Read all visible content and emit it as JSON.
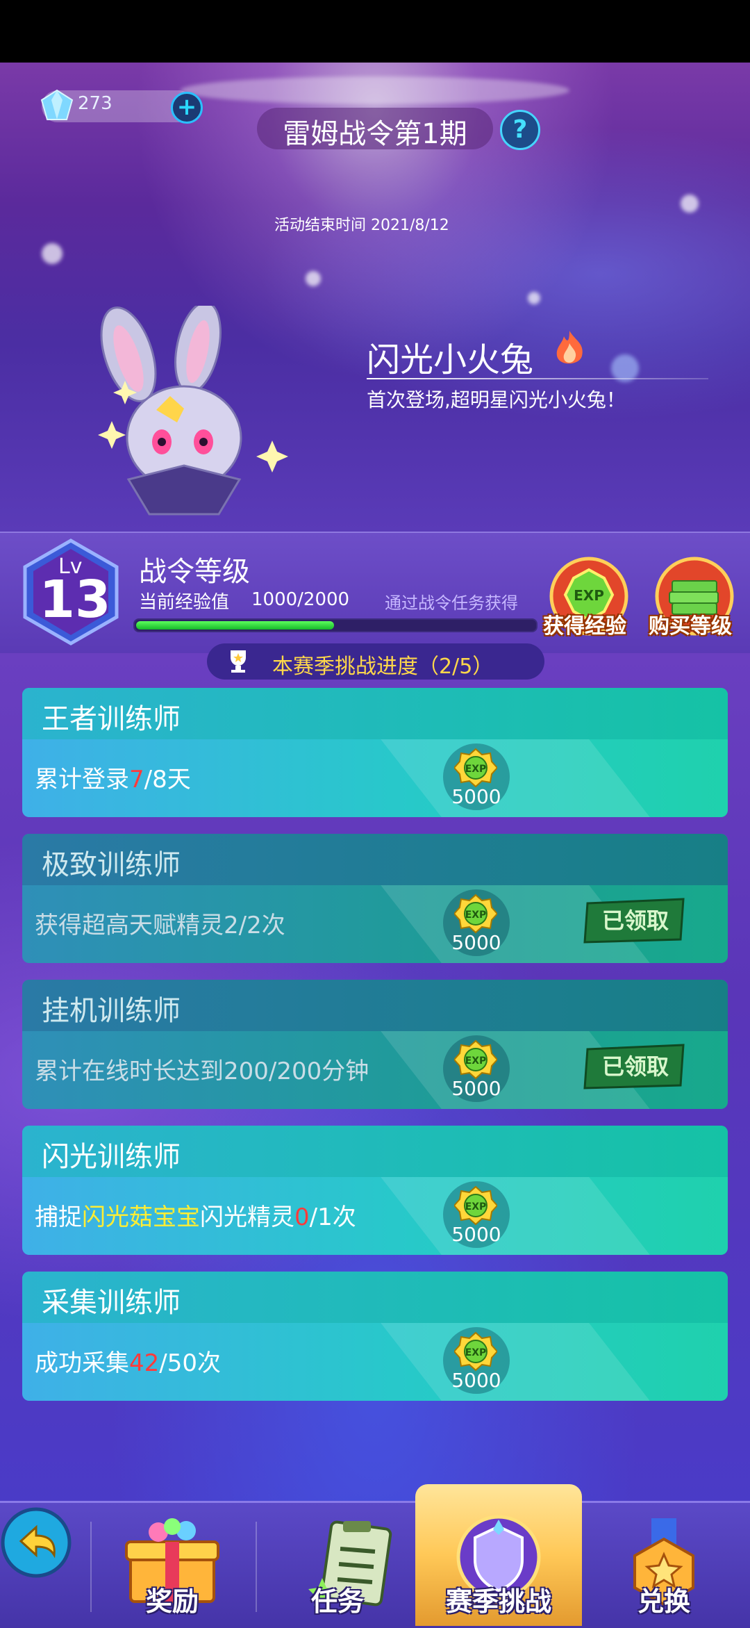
{
  "header": {
    "gem_count": "273",
    "event_title": "雷姆战令第1期",
    "event_end": "活动结束时间 2021/8/12",
    "help": "?"
  },
  "featured_pet": {
    "name": "闪光小火兔",
    "description": "首次登场,超明星闪光小火兔！"
  },
  "level": {
    "lv_label": "Lv",
    "level": "13",
    "title": "战令等级",
    "exp_label": "当前经验值",
    "exp_value": "1000/2000",
    "exp_progress": 0.5,
    "hint": "通过战令任务获得",
    "get_exp_label": "获得经验",
    "buy_level_label": "购买等级",
    "exp_icon_text": "EXP"
  },
  "season": {
    "progress_text": "本赛季挑战进度（2/5）"
  },
  "challenges": [
    {
      "title": "王者训练师",
      "desc_pre": "累计登录",
      "desc_hl": "7",
      "desc_post": "/8天",
      "reward": "5000",
      "claimed": false
    },
    {
      "title": "极致训练师",
      "desc_pre": "获得超高天赋精灵2/2次",
      "desc_hl": "",
      "desc_post": "",
      "reward": "5000",
      "claimed": true
    },
    {
      "title": "挂机训练师",
      "desc_pre": "累计在线时长达到200/200分钟",
      "desc_hl": "",
      "desc_post": "",
      "reward": "5000",
      "claimed": true
    },
    {
      "title": "闪光训练师",
      "desc_pre": "捕捉",
      "desc_hl_yellow": "闪光菇宝宝",
      "desc_mid": "闪光精灵",
      "desc_hl": "0",
      "desc_post": "/1次",
      "reward": "5000",
      "claimed": false
    },
    {
      "title": "采集训练师",
      "desc_pre": "成功采集",
      "desc_hl": "42",
      "desc_post": "/50次",
      "reward": "5000",
      "claimed": false
    }
  ],
  "claimed_label": "已领取",
  "nav": {
    "items": [
      {
        "label": "奖励"
      },
      {
        "label": "任务"
      },
      {
        "label": "赛季挑战"
      },
      {
        "label": "兑换"
      }
    ]
  },
  "colors": {
    "accent_green": "#16b82a",
    "highlight_red": "#ff3b3b",
    "highlight_yellow": "#ffee33",
    "progress_gold": "#ffd84a"
  }
}
